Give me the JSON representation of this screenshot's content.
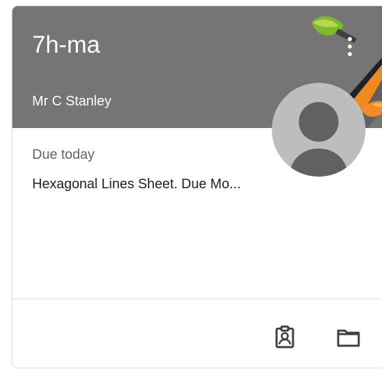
{
  "class_card": {
    "title": "7h-ma",
    "teacher": "Mr C Stanley",
    "due_label": "Due today",
    "assignment": "Hexagonal Lines Sheet. Due Mo...",
    "header_color": "#757575",
    "icons": {
      "menu": "more-vertical-icon",
      "avatar": "person-icon",
      "work": "assignment-ind-icon",
      "folder": "folder-icon"
    }
  }
}
